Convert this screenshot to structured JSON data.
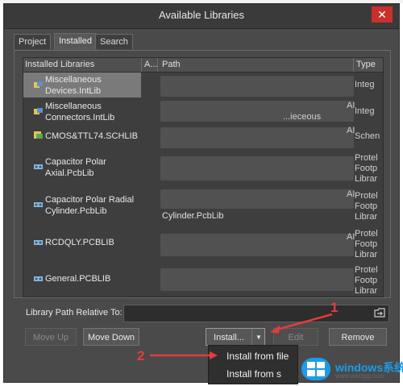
{
  "window": {
    "title": "Available Libraries"
  },
  "tabs": [
    "Project",
    "Installed",
    "Search Path"
  ],
  "grid": {
    "headers": {
      "name": "Installed Libraries",
      "a": "A...",
      "path": "Path",
      "type": "Type"
    },
    "rows": [
      {
        "name_l1": "Miscellaneous",
        "name_l2": "Devices.IntLib",
        "a": "",
        "path": "",
        "ai": "",
        "type": [
          "Integ"
        ]
      },
      {
        "name_l1": "Miscellaneous",
        "name_l2": "Connectors.IntLib",
        "a": "",
        "path": "...ieceous",
        "ai": "AI",
        "type": [
          "Integ"
        ]
      },
      {
        "name_l1": "CMOS&TTL74.SCHLIB",
        "name_l2": "",
        "a": "",
        "path": "",
        "ai": "AI",
        "type": [
          "Schen"
        ]
      },
      {
        "name_l1": "Capacitor Polar",
        "name_l2": "Axial.PcbLib",
        "a": "",
        "path": "",
        "ai": "",
        "type": [
          "Protel",
          "Footp",
          "Librar"
        ]
      },
      {
        "name_l1": "Capacitor Polar Radial",
        "name_l2": "Cylinder.PcbLib",
        "a": "",
        "path": "Cylinder.PcbLib",
        "ai": "AI",
        "type": [
          "Protel",
          "Footp",
          "Librar"
        ]
      },
      {
        "name_l1": "RCDQLY.PCBLIB",
        "name_l2": "",
        "a": "",
        "path": "",
        "ai": "AI",
        "type": [
          "Protel",
          "Footp",
          "Librar"
        ]
      },
      {
        "name_l1": "General.PCBLIB",
        "name_l2": "",
        "a": "",
        "path": "",
        "ai": "",
        "type": [
          "Protel",
          "Footp",
          "Librar"
        ]
      }
    ]
  },
  "library_path_relative_to": {
    "label": "Library Path Relative To:",
    "value": ""
  },
  "buttons": {
    "move_up": "Move Up",
    "move_down": "Move Down",
    "install": "Install...",
    "install_arrow": "▼",
    "edit": "Edit",
    "remove": "Remove"
  },
  "install_menu": [
    "Install from file",
    "Install from s"
  ],
  "annotations": [
    "1",
    "2"
  ],
  "watermark": {
    "text": "windows系统城",
    "url": "www.wxclgg.com"
  },
  "colors": {
    "dialog_bg": "#4a4a4a",
    "selection": "#7a7a7a",
    "annotation": "#e53b3b"
  }
}
